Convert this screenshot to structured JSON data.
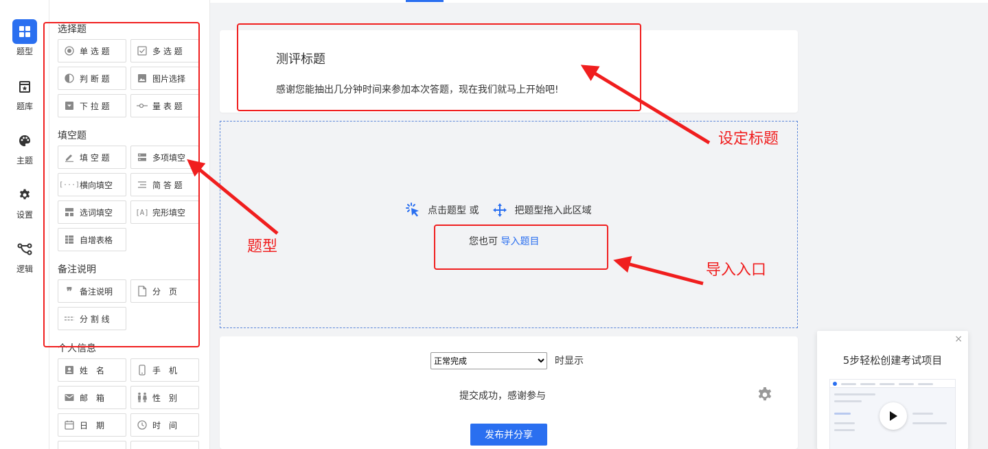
{
  "rail": {
    "items": [
      {
        "label": "题型",
        "icon": "grid-icon",
        "active": true
      },
      {
        "label": "题库",
        "icon": "bank-icon"
      },
      {
        "label": "主题",
        "icon": "palette-icon"
      },
      {
        "label": "设置",
        "icon": "gear-icon"
      },
      {
        "label": "逻辑",
        "icon": "logic-icon"
      }
    ]
  },
  "panel": {
    "sections": {
      "choice": "选择题",
      "fill": "填空题",
      "note": "备注说明",
      "personal": "个人信息"
    },
    "buttons": {
      "single": "单 选 题",
      "multi": "多 选 题",
      "judge": "判 断 题",
      "image": "图片选择",
      "dropdown": "下 拉 题",
      "scale": "量 表 题",
      "fill": "填 空 题",
      "multifill": "多项填空",
      "hfill": "横向填空",
      "short": "简 答 题",
      "wordfill": "选词填空",
      "cloze": "完形填空",
      "table": "自增表格",
      "remark": "备注说明",
      "page": "分　页",
      "divider": "分 割 线",
      "name": "姓　名",
      "phone": "手　机",
      "email": "邮　箱",
      "gender": "性　别",
      "date": "日　期",
      "time": "时　间"
    }
  },
  "main": {
    "survey_title": "测评标题",
    "survey_desc": "感谢您能抽出几分钟时间来参加本次答题，现在我们就马上开始吧!",
    "drop_hint_click": "点击题型 或",
    "drop_hint_drag": "把题型拖入此区域",
    "import_prefix": "您也可",
    "import_link": "导入题目",
    "end_select_value": "正常完成",
    "end_after": "时显示",
    "end_msg": "提交成功，感谢参与",
    "publish_label": "发布并分享"
  },
  "promo": {
    "close": "×",
    "title": "5步轻松创建考试项目"
  },
  "annotations": {
    "title_label": "设定标题",
    "type_label": "题型",
    "import_label": "导入入口"
  },
  "colors": {
    "accent": "#2a6ff0",
    "annotation": "#f01e1e"
  }
}
